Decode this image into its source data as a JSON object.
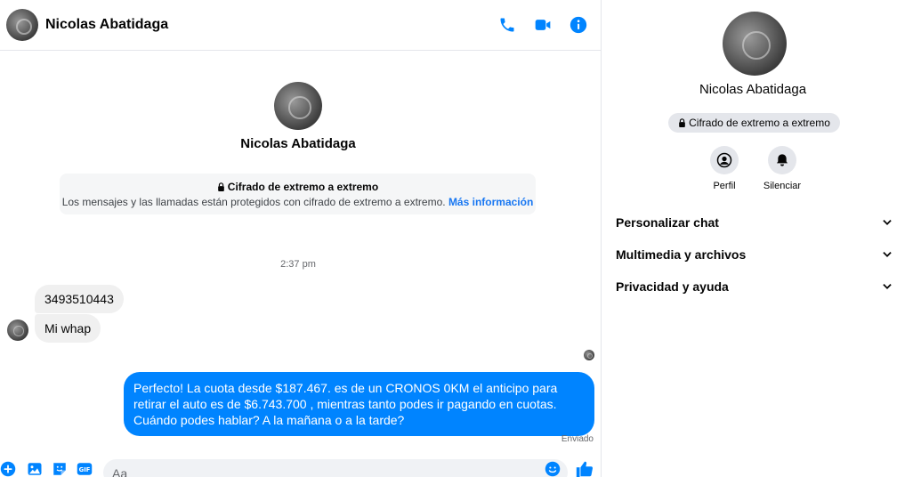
{
  "contact": {
    "name": "Nicolas Abatidaga"
  },
  "header": {
    "icons": {
      "call": "phone-icon",
      "video": "video-camera-icon",
      "info": "info-icon"
    },
    "accent_color": "#0084ff"
  },
  "intro": {
    "name": "Nicolas Abatidaga",
    "e2e_title": "Cifrado de extremo a extremo",
    "e2e_desc": "Los mensajes y las llamadas están protegidos con cifrado de extremo a extremo.",
    "e2e_link": "Más información"
  },
  "messages": {
    "timestamp": "2:37 pm",
    "incoming": [
      "3493510443",
      "Mi whap"
    ],
    "outgoing_text": "Perfecto! La cuota desde $187.467. es de un CRONOS 0KM el anticipo para retirar el auto es de $6.743.700 , mientras tanto podes ir pagando en cuotas. Cuándo podes hablar? A la mañana o a la tarde?",
    "status": "Enviado"
  },
  "composer": {
    "placeholder": "Aa"
  },
  "panel": {
    "name": "Nicolas Abatidaga",
    "badge": "Cifrado de extremo a extremo",
    "actions": [
      {
        "label": "Perfil",
        "icon": "profile-icon"
      },
      {
        "label": "Silenciar",
        "icon": "bell-icon"
      }
    ],
    "sections": [
      "Personalizar chat",
      "Multimedia y archivos",
      "Privacidad y ayuda"
    ]
  },
  "colors": {
    "outgoing_bubble": "#0084ff",
    "incoming_bubble": "#f0f0f0",
    "link": "#1877f2"
  }
}
